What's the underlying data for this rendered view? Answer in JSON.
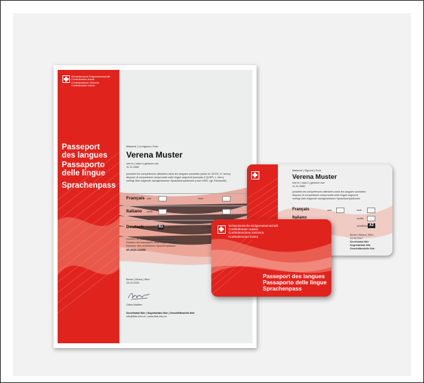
{
  "document": {
    "confederation": [
      "Schweizerische Eidgenossenschaft",
      "Confédération suisse",
      "Confederazione Svizzera",
      "Confederaziun svizra"
    ],
    "titles": [
      "Passeport",
      "des langues",
      "Passaporto",
      "delle lingue",
      "Sprachenpass"
    ],
    "salutation": "Madame | La signora | Frau",
    "holder_name": "Verena Muster",
    "born_line": "née le | nata il | geboren am",
    "birth_date": "11.11.1986",
    "statement": [
      "possède les compétences attestées dans les langues suivantes (selon le CECR, cf. verso)",
      "dispone di competenze comprovate nelle lingue seguenti (secondo il QCER, v. retro)",
      "verfügt über folgende nachgewiesene Sprachkompetenzen (nach GER, vgl. Rückseite)"
    ],
    "languages": [
      {
        "name": "Français",
        "mode1": "oral",
        "box1": "–",
        "mode2": "écrit",
        "box2": "–"
      },
      {
        "name": "Italiano",
        "mode1": "orale",
        "box1": "–",
        "mode2": "scritto",
        "box2": "–"
      },
      {
        "name": "Deutsch",
        "mode1": "mündlich",
        "level": "B1",
        "date": "18.02.2020",
        "mode2": "schriftlich",
        "box2": "–"
      }
    ],
    "passport_number_labels": [
      "Numéro du passeport des langues délivré",
      "Numero del passaporto delle lingue rilasciato",
      "Nummer des verliehenen Sprachenpasses"
    ],
    "passport_number": "SF-2020-123456",
    "place": "Berne | Berna | Bern",
    "issue_date": "03.03.2020",
    "signatory": "Olivia Walther",
    "secretariat": "Secrétariat fide | Segretariato fide | Geschäftsstelle fide",
    "contact": "info@fide-info.ch | www.fide-info.ch"
  },
  "card_back": {
    "salutation": "Madame | Signora | Frau",
    "holder_name": "Verena Muster",
    "born_line": "née le | nata il | geboren am",
    "birth_date": "11.11.1986",
    "statement": [
      "possède les compétences attestées dans les langues suivantes",
      "dispone di competenze comprovate nelle lingue seguenti",
      "verfügt über folgende nachgewiesene Sprachkompetenzen"
    ],
    "languages": [
      {
        "name": "Français",
        "mode1": "oral",
        "box1": "–",
        "mode2": "écrit",
        "box2": "–"
      },
      {
        "name": "Italiano",
        "mode2": "scritto",
        "box2": "–"
      }
    ],
    "extra_mode": "schriftlich",
    "extra_level": "A2",
    "place_fragment": "Berne | Berna | Bern",
    "date_fragment": "03.06.2017",
    "secretariat_lines": [
      "Secrétariat fide",
      "Segretariato fide",
      "Geschäftsstelle fide"
    ]
  },
  "card_front": {
    "confederation": [
      "Schweizerische Eidgenossenschaft",
      "Confédération suisse",
      "Confederazione Svizzera",
      "Confederaziun svizra"
    ],
    "titles": [
      "Passeport des langues",
      "Passaporto delle lingue",
      "Sprachenpass"
    ]
  },
  "colors": {
    "swiss_red": "#e1231d",
    "background": "#f2f2f2"
  },
  "icons": [
    "swiss-cross-icon"
  ]
}
